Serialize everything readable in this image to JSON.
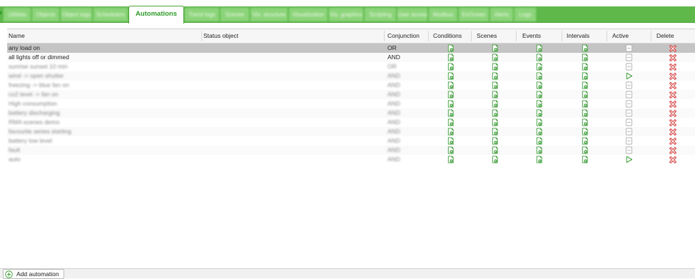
{
  "tabs": [
    {
      "label": "Utilities",
      "active": false
    },
    {
      "label": "Objects",
      "active": false
    },
    {
      "label": "Object logs",
      "active": false
    },
    {
      "label": "Schedulers",
      "active": false
    },
    {
      "label": "Automations",
      "active": true
    },
    {
      "label": "Trend logs",
      "active": false
    },
    {
      "label": "Scenes",
      "active": false
    },
    {
      "label": "Vis. structure",
      "active": false
    },
    {
      "label": "Visualization",
      "active": false
    },
    {
      "label": "Vis. graphics",
      "active": false
    },
    {
      "label": "Scripting",
      "active": false
    },
    {
      "label": "User access",
      "active": false
    },
    {
      "label": "Modbus",
      "active": false
    },
    {
      "label": "EnOcean",
      "active": false
    },
    {
      "label": "Alerts",
      "active": false
    },
    {
      "label": "Logs",
      "active": false
    }
  ],
  "columns": {
    "name": "Name",
    "status_object": "Status object",
    "conjunction": "Conjunction",
    "conditions": "Conditions",
    "scenes": "Scenes",
    "events": "Events",
    "intervals": "Intervals",
    "active": "Active",
    "delete": "Delete"
  },
  "rows": [
    {
      "name": "any load on",
      "status_object": "",
      "conjunction": "OR",
      "active": false,
      "selected": true,
      "blurred": false
    },
    {
      "name": "all lights off or dimmed",
      "status_object": "",
      "conjunction": "AND",
      "active": false,
      "selected": false,
      "blurred": false
    },
    {
      "name": "sunrise sunset 10 min",
      "status_object": "",
      "conjunction": "OR",
      "active": false,
      "selected": false,
      "blurred": true
    },
    {
      "name": "wind -> open shutter",
      "status_object": "",
      "conjunction": "AND",
      "active": true,
      "selected": false,
      "blurred": true
    },
    {
      "name": "freezing -> blue fan on",
      "status_object": "",
      "conjunction": "AND",
      "active": false,
      "selected": false,
      "blurred": true
    },
    {
      "name": "co2 level -> fan on",
      "status_object": "",
      "conjunction": "AND",
      "active": false,
      "selected": false,
      "blurred": true
    },
    {
      "name": "High consumption",
      "status_object": "",
      "conjunction": "AND",
      "active": false,
      "selected": false,
      "blurred": true
    },
    {
      "name": "battery discharging",
      "status_object": "",
      "conjunction": "AND",
      "active": false,
      "selected": false,
      "blurred": true
    },
    {
      "name": "RMA scenes demo",
      "status_object": "",
      "conjunction": "AND",
      "active": false,
      "selected": false,
      "blurred": true
    },
    {
      "name": "favourite series starting",
      "status_object": "",
      "conjunction": "AND",
      "active": false,
      "selected": false,
      "blurred": true
    },
    {
      "name": "battery low level",
      "status_object": "",
      "conjunction": "AND",
      "active": false,
      "selected": false,
      "blurred": true
    },
    {
      "name": "fault",
      "status_object": "",
      "conjunction": "AND",
      "active": false,
      "selected": false,
      "blurred": true
    },
    {
      "name": "auto",
      "status_object": "",
      "conjunction": "AND",
      "active": true,
      "selected": false,
      "blurred": true
    }
  ],
  "footer": {
    "add_label": "Add automation"
  },
  "colors": {
    "accent": "#5fb84a",
    "icon_green": "#3f9e3a",
    "delete_red": "#d64545"
  }
}
